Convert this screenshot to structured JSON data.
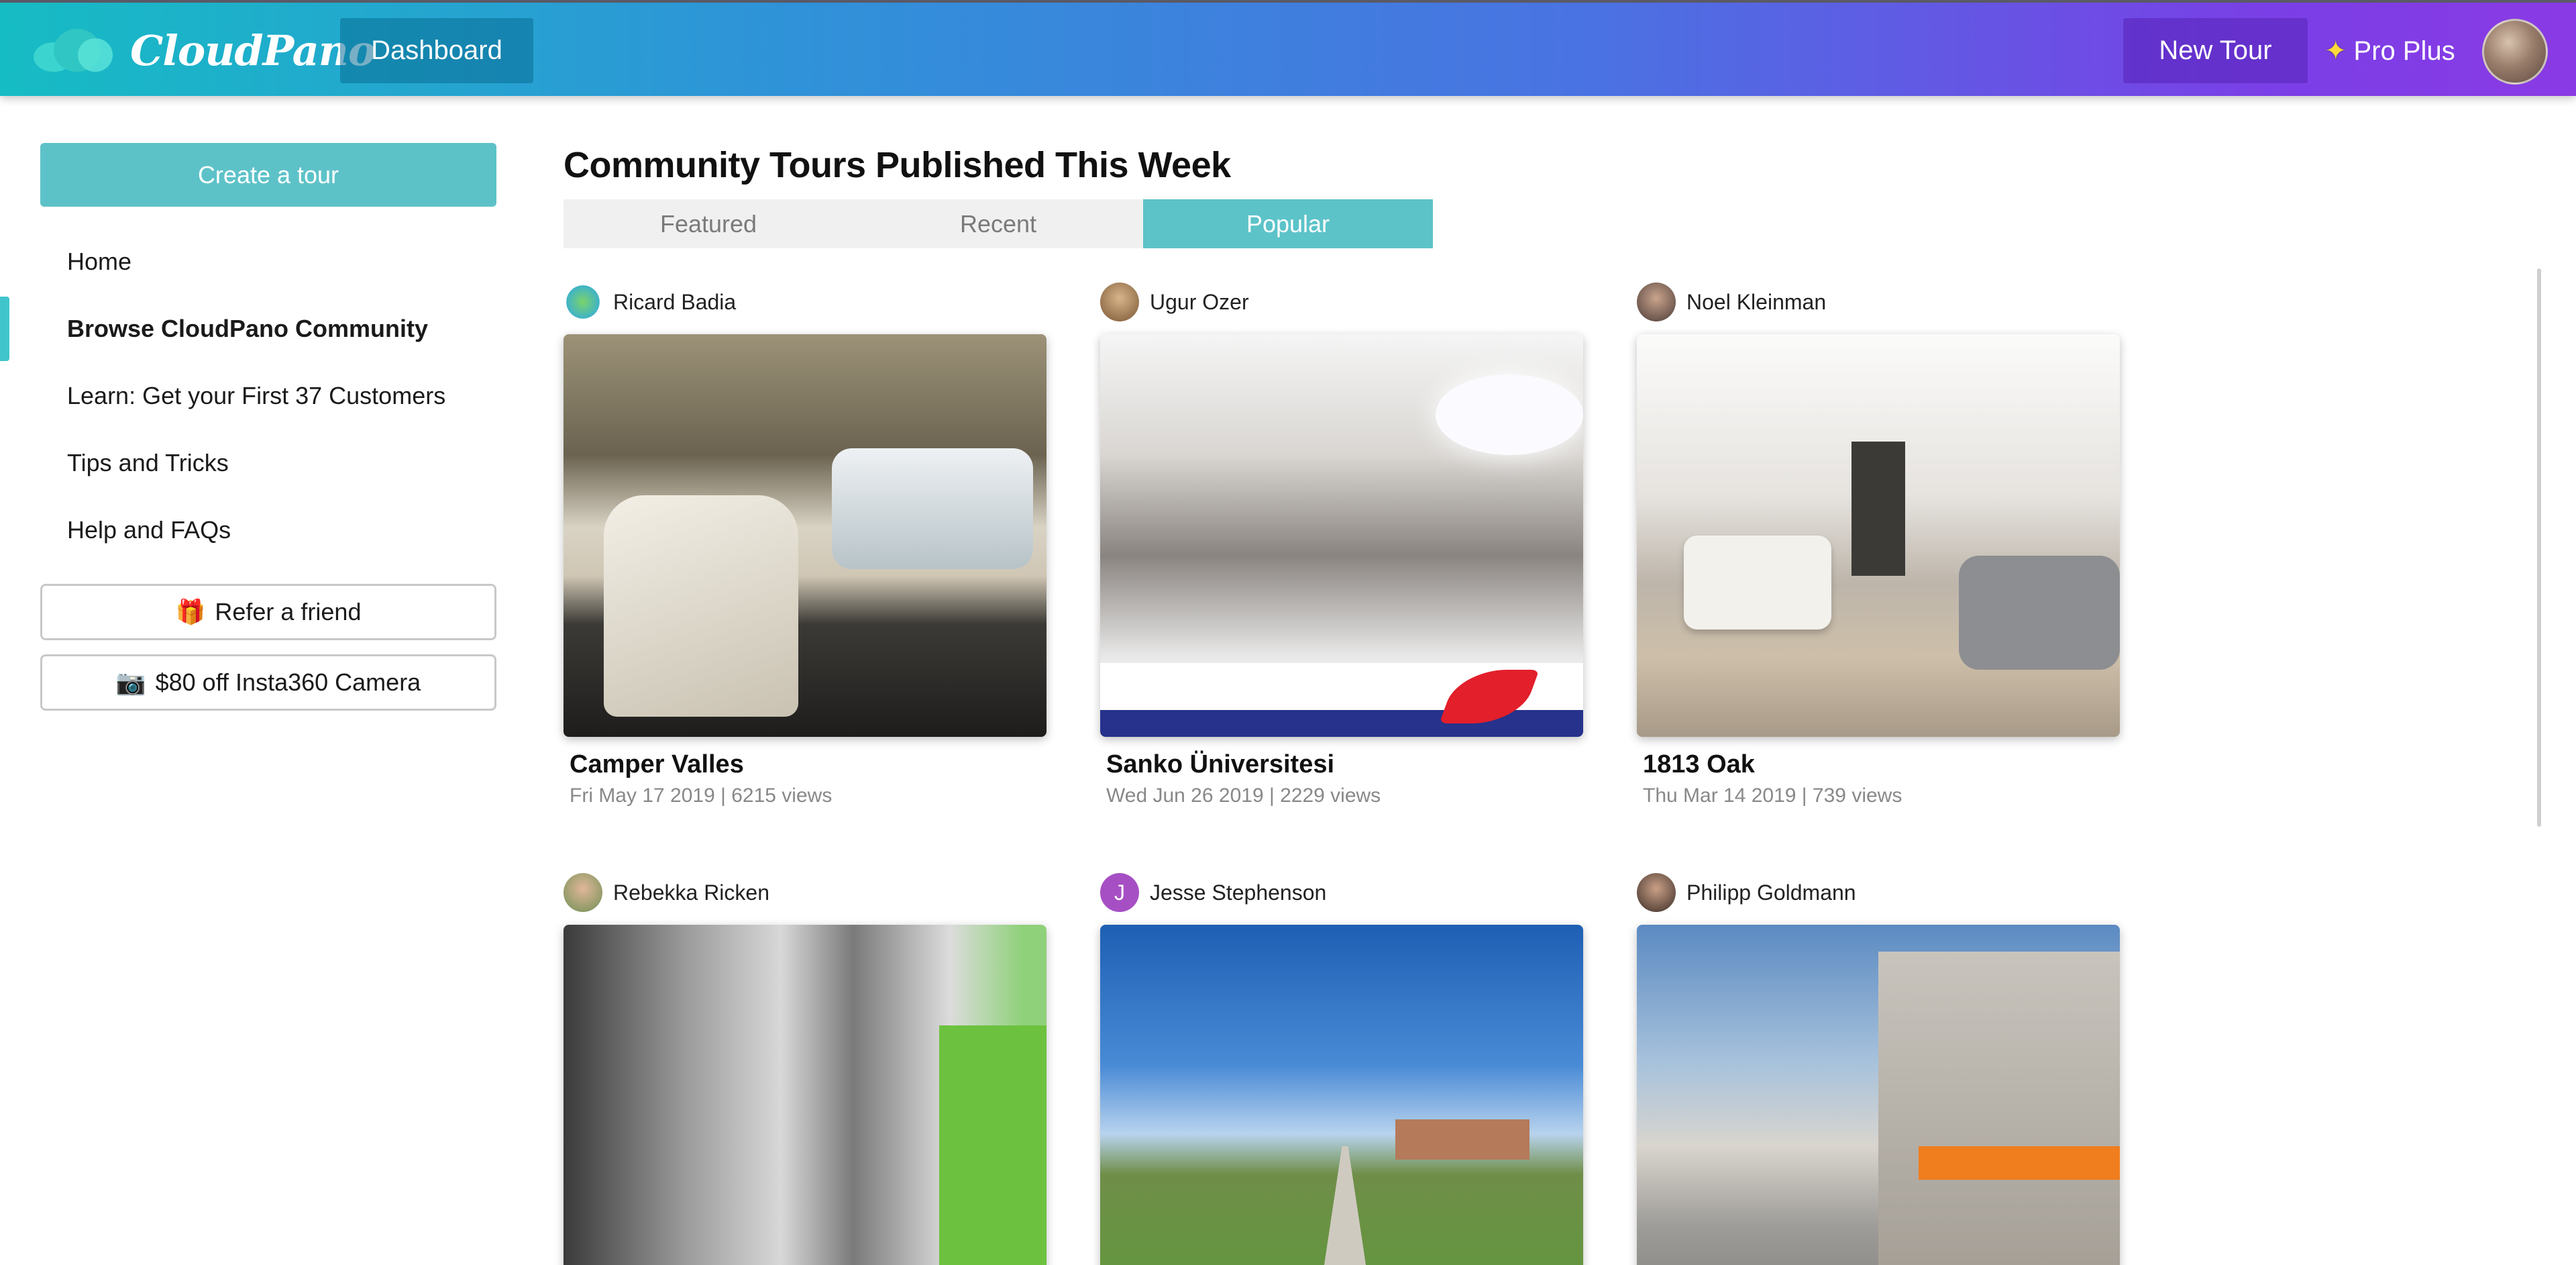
{
  "topbar": {
    "logo_text": "CloudPano",
    "dashboard_label": "Dashboard",
    "new_tour_label": "New Tour",
    "plan_label": "Pro Plus",
    "plan_icon": "sparkle-star-icon"
  },
  "sidebar": {
    "create_label": "Create a tour",
    "items": [
      {
        "label": "Home",
        "active": false
      },
      {
        "label": "Browse CloudPano Community",
        "active": true
      },
      {
        "label": "Learn: Get your First 37 Customers",
        "active": false
      },
      {
        "label": "Tips and Tricks",
        "active": false
      },
      {
        "label": "Help and FAQs",
        "active": false
      }
    ],
    "refer_label": "Refer a friend",
    "refer_icon": "gift-icon",
    "insta_label": "$80 off Insta360 Camera",
    "insta_icon": "camera-icon"
  },
  "main": {
    "title": "Community Tours Published This Week",
    "tabs": [
      {
        "label": "Featured",
        "active": false
      },
      {
        "label": "Recent",
        "active": false
      },
      {
        "label": "Popular",
        "active": true
      }
    ],
    "tours": [
      {
        "author": "Ricard Badia",
        "title": "Camper Valles",
        "meta": "Fri May 17 2019 | 6215 views"
      },
      {
        "author": "Ugur Ozer",
        "title": "Sanko Üniversitesi",
        "meta": "Wed Jun 26 2019 | 2229 views"
      },
      {
        "author": "Noel Kleinman",
        "title": "1813 Oak",
        "meta": "Thu Mar 14 2019 | 739 views"
      },
      {
        "author": "Rebekka Ricken",
        "title": "",
        "meta": ""
      },
      {
        "author": "Jesse Stephenson",
        "avatar_initial": "J",
        "title": "",
        "meta": ""
      },
      {
        "author": "Philipp Goldmann",
        "title": "",
        "meta": ""
      }
    ]
  },
  "colors": {
    "accent_teal": "#5cc3c9",
    "gradient_start": "#16bcc4",
    "gradient_end": "#8a3ae4"
  }
}
